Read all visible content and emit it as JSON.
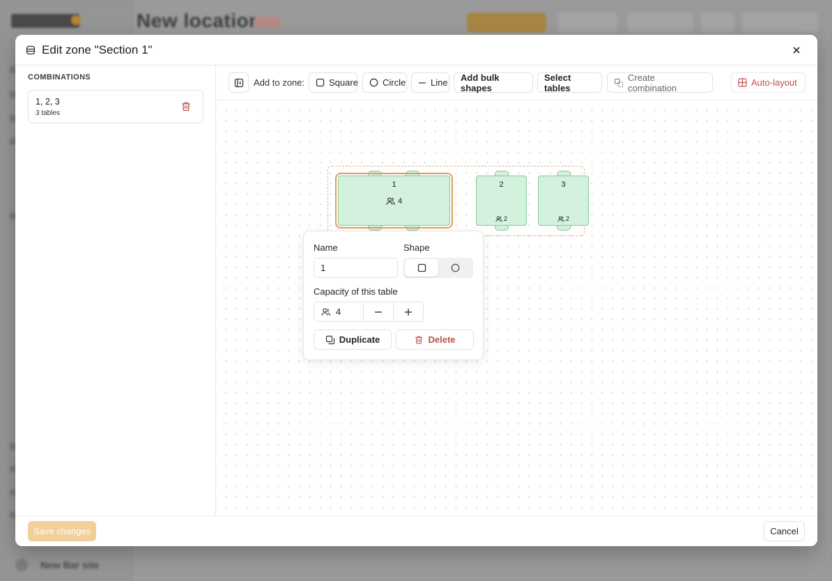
{
  "background": {
    "page_title": "New location",
    "footer_user": "New Bar site"
  },
  "modal": {
    "title": "Edit zone \"Section 1\"",
    "close_icon": "close-icon",
    "sidebar": {
      "section_label": "COMBINATIONS",
      "combinations": [
        {
          "name": "1, 2, 3",
          "sub": "3 tables"
        }
      ]
    },
    "toolbar": {
      "add_to_zone_label": "Add to zone:",
      "square_label": "Square",
      "circle_label": "Circle",
      "line_label": "Line",
      "bulk_label": "Add bulk shapes",
      "select_tables_label": "Select tables",
      "create_combination_label": "Create combination",
      "auto_layout_label": "Auto-layout"
    },
    "tables": [
      {
        "name": "1",
        "capacity": "4",
        "selected": true
      },
      {
        "name": "2",
        "capacity": "2",
        "selected": false
      },
      {
        "name": "3",
        "capacity": "2",
        "selected": false
      }
    ],
    "popover": {
      "name_label": "Name",
      "name_value": "1",
      "shape_label": "Shape",
      "shape_selected": "square",
      "capacity_label": "Capacity of this table",
      "capacity_value": "4",
      "duplicate_label": "Duplicate",
      "delete_label": "Delete"
    },
    "footer": {
      "save_label": "Save changes",
      "cancel_label": "Cancel"
    }
  },
  "colors": {
    "accent": "#d97b57",
    "table_fill": "#d3f1dc",
    "table_border": "#86c99a",
    "delete": "#c0504d",
    "save_bg": "#f0cf9a"
  }
}
